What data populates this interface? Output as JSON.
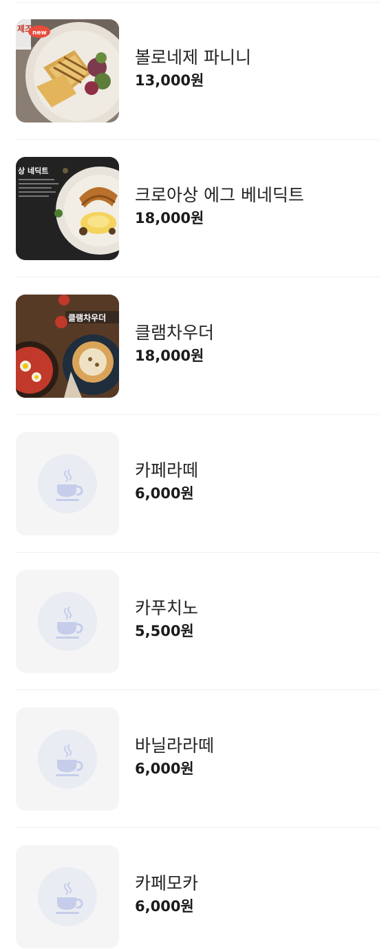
{
  "menu": {
    "items": [
      {
        "name": "볼로네제 파니니",
        "price": "13,000원",
        "image": "panini-photo",
        "badge": "new",
        "thumb_text": "제즈"
      },
      {
        "name": "크로아상 에그 베네딕트",
        "price": "18,000원",
        "image": "croissant-benedict-photo",
        "thumb_text": "상 네딕트"
      },
      {
        "name": "클램차우더",
        "price": "18,000원",
        "image": "clam-chowder-photo",
        "thumb_text": "클램차우더"
      },
      {
        "name": "카페라떼",
        "price": "6,000원",
        "image": "coffee-cup-icon"
      },
      {
        "name": "카푸치노",
        "price": "5,500원",
        "image": "coffee-cup-icon"
      },
      {
        "name": "바닐라라떼",
        "price": "6,000원",
        "image": "coffee-cup-icon"
      },
      {
        "name": "카페모카",
        "price": "6,000원",
        "image": "coffee-cup-icon"
      }
    ]
  },
  "colors": {
    "placeholder_bg": "#f5f5f5",
    "placeholder_circle": "#e9ecf3",
    "cup_icon": "#c5cdea",
    "divider": "#efefef"
  }
}
